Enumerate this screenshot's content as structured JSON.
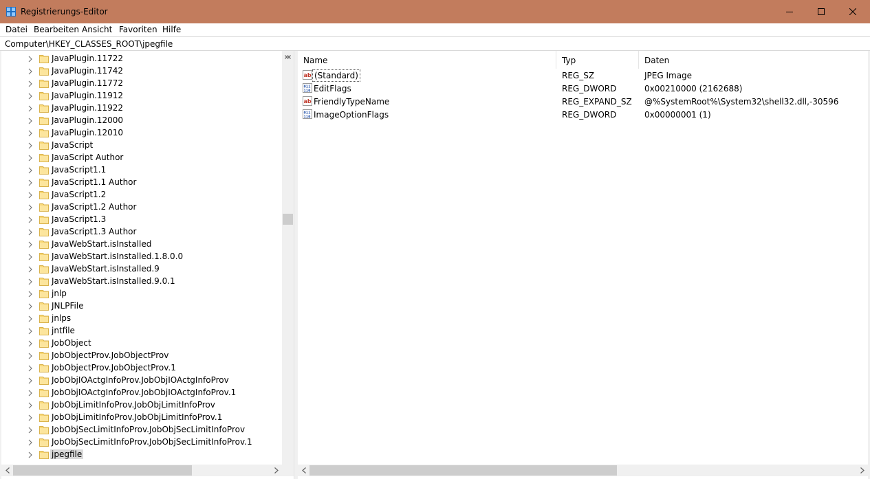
{
  "window": {
    "title": "Registrierungs-Editor",
    "titlebar_color": "#c27c5d"
  },
  "menu": {
    "items": [
      "Datei",
      "Bearbeiten",
      "Ansicht",
      "Favoriten",
      "Hilfe"
    ]
  },
  "address": {
    "path": "Computer\\HKEY_CLASSES_ROOT\\jpegfile"
  },
  "tree": {
    "selected": "jpegfile",
    "items": [
      "JavaPlugin.11722",
      "JavaPlugin.11742",
      "JavaPlugin.11772",
      "JavaPlugin.11912",
      "JavaPlugin.11922",
      "JavaPlugin.12000",
      "JavaPlugin.12010",
      "JavaScript",
      "JavaScript Author",
      "JavaScript1.1",
      "JavaScript1.1 Author",
      "JavaScript1.2",
      "JavaScript1.2 Author",
      "JavaScript1.3",
      "JavaScript1.3 Author",
      "JavaWebStart.isInstalled",
      "JavaWebStart.isInstalled.1.8.0.0",
      "JavaWebStart.isInstalled.9",
      "JavaWebStart.isInstalled.9.0.1",
      "jnlp",
      "JNLPFile",
      "jnlps",
      "jntfile",
      "JobObject",
      "JobObjectProv.JobObjectProv",
      "JobObjectProv.JobObjectProv.1",
      "JobObjIOActgInfoProv.JobObjIOActgInfoProv",
      "JobObjIOActgInfoProv.JobObjIOActgInfoProv.1",
      "JobObjLimitInfoProv.JobObjLimitInfoProv",
      "JobObjLimitInfoProv.JobObjLimitInfoProv.1",
      "JobObjSecLimitInfoProv.JobObjSecLimitInfoProv",
      "JobObjSecLimitInfoProv.JobObjSecLimitInfoProv.1",
      "jpegfile"
    ]
  },
  "values": {
    "columns": {
      "name": "Name",
      "type": "Typ",
      "data": "Daten"
    },
    "rows": [
      {
        "icon": "string-value-icon",
        "name": "(Standard)",
        "type": "REG_SZ",
        "data": "JPEG Image"
      },
      {
        "icon": "binary-value-icon",
        "name": "EditFlags",
        "type": "REG_DWORD",
        "data": "0x00210000 (2162688)"
      },
      {
        "icon": "string-value-icon",
        "name": "FriendlyTypeName",
        "type": "REG_EXPAND_SZ",
        "data": "@%SystemRoot%\\System32\\shell32.dll,-30596"
      },
      {
        "icon": "binary-value-icon",
        "name": "ImageOptionFlags",
        "type": "REG_DWORD",
        "data": "0x00000001 (1)"
      }
    ]
  }
}
